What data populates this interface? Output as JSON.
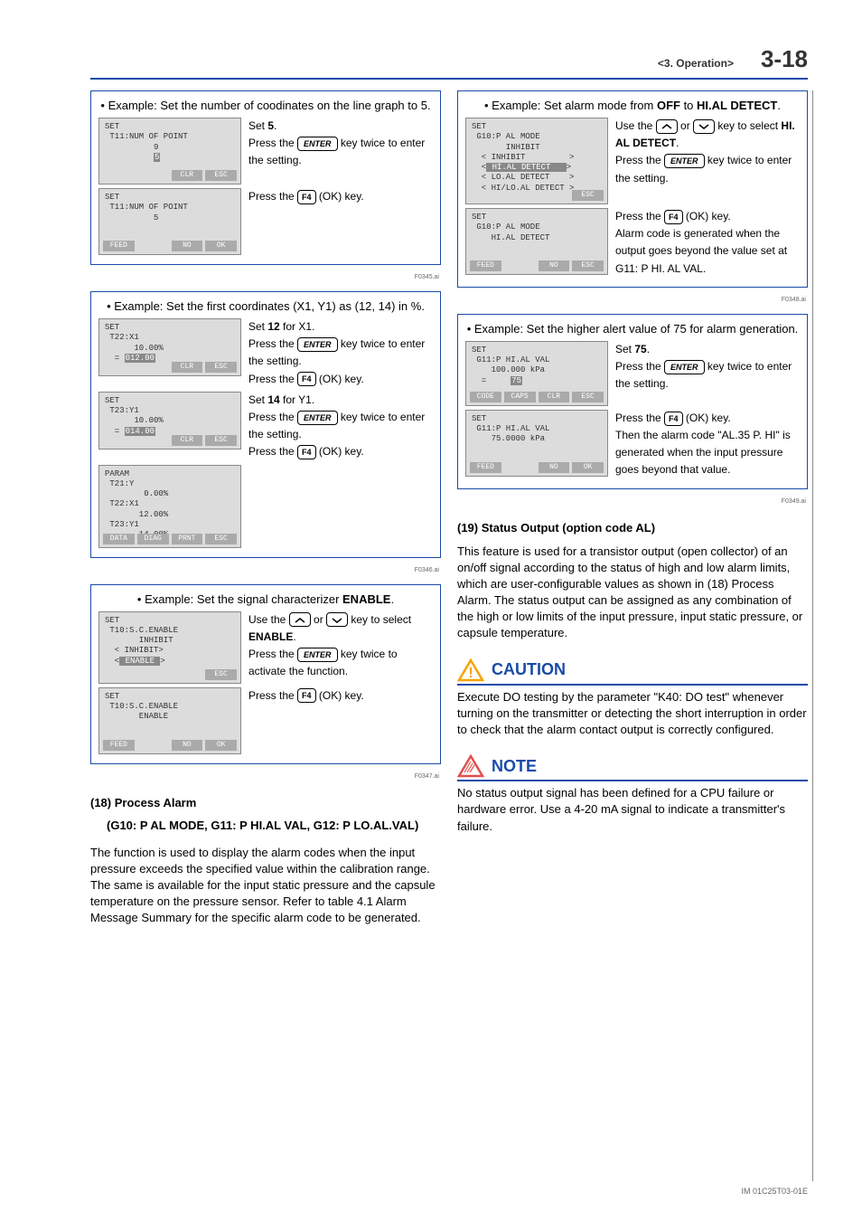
{
  "header": {
    "section": "<3. Operation>",
    "page": "3-18"
  },
  "footer": {
    "doc_id": "IM 01C25T03-01E"
  },
  "col_left": {
    "box1": {
      "title_pre": "• Example: Set the number of coodinates on the line graph to 5.",
      "lcd1": {
        "l1": "SET",
        "l2": " T11:NUM OF POINT",
        "l3": "          9",
        "l4_hl": "5",
        "foot": [
          "",
          "",
          "CLR",
          "ESC"
        ]
      },
      "instr1a": "Set ",
      "instr1b": "5",
      "instr1c": ".",
      "instr2a": "Press the ",
      "key_enter": "ENTER",
      "instr2b": " key twice to enter the setting.",
      "lcd2": {
        "l1": "SET",
        "l2": " T11:NUM OF POINT",
        "l3": "          5",
        "foot": [
          "FEED",
          "",
          "NO",
          "OK"
        ]
      },
      "instr3a": "Press the ",
      "key_f4": "F4",
      "instr3b": " (OK) key.",
      "ref": "F0345.ai"
    },
    "box2": {
      "title": "• Example: Set the first coordinates (X1, Y1) as (12, 14) in %.",
      "lcd1": {
        "l1": "SET",
        "l2": " T22:X1",
        "l3": "      10.00%",
        "l4_pre": "  = ",
        "l4_hl": "012.00",
        "foot": [
          "",
          "",
          "CLR",
          "ESC"
        ]
      },
      "i1a": "Set ",
      "i1b": "12",
      "i1c": " for X1.",
      "i2a": "Press the ",
      "i2b": " key twice to enter the setting.",
      "i3a": "Press the ",
      "i3b": " (OK) key.",
      "lcd2": {
        "l1": "SET",
        "l2": " T23:Y1",
        "l3": "      10.00%",
        "l4_pre": "  = ",
        "l4_hl": "014.00",
        "foot": [
          "",
          "",
          "CLR",
          "ESC"
        ]
      },
      "i4a": "Set ",
      "i4b": "14",
      "i4c": " for Y1.",
      "lcd3": {
        "l1": "PARAM",
        "l2": " T21:Y",
        "l3": "        0.00%",
        "l4": " T22:X1",
        "l5": "       12.00%",
        "l6": " T23:Y1",
        "l7": "       14.00%",
        "foot": [
          "DATA",
          "DIAG",
          "PRNT",
          "ESC"
        ]
      },
      "ref": "F0346.ai"
    },
    "box3": {
      "title": "• Example: Set the signal characterizer ",
      "title_b": "ENABLE",
      "title_post": ".",
      "lcd1": {
        "l1": "SET",
        "l2": " T10:S.C.ENABLE",
        "l3": "       INHIBIT",
        "l4": "  < INHIBIT>",
        "l5pre": "  <",
        "l5hl": " ENABLE ",
        "l5post": ">",
        "foot": [
          "",
          "",
          "",
          "ESC"
        ]
      },
      "i1a": "Use the ",
      "i1b": " or ",
      "i1c": " key to select ",
      "i1d": "ENABLE",
      "i1e": ".",
      "i2a": "Press the ",
      "i2b": " key twice to activate the function.",
      "lcd2": {
        "l1": "SET",
        "l2": " T10:S.C.ENABLE",
        "l3": "       ENABLE",
        "foot": [
          "FEED",
          "",
          "NO",
          "OK"
        ]
      },
      "i3a": "Press the ",
      "i3b": " (OK) key.",
      "ref": "F0347.ai"
    },
    "sec18": {
      "num": "(18) Process Alarm",
      "sub": "(G10: P AL MODE, G11: P HI.AL VAL, G12: P LO.AL.VAL)",
      "body": "The function is used to display the alarm codes when the input pressure exceeds the specified value within the calibration range. The same is available for the input static pressure and the capsule temperature on the pressure sensor. Refer to table 4.1 Alarm Message Summary for the specific alarm code to be generated."
    }
  },
  "col_right": {
    "box1": {
      "title_a": "• Example: Set alarm mode from ",
      "title_b": "OFF",
      "title_c": " to ",
      "title_d": "HI.AL DETECT",
      "title_e": ".",
      "lcd1": {
        "l1": "SET",
        "l2": " G10:P AL MODE",
        "l3": "       INHIBIT",
        "l4": "  < INHIBIT         >",
        "l5pre": "  <",
        "l5hl": " HI.AL DETECT   ",
        "l5post": ">",
        "l6": "  < LO.AL DETECT    >",
        "l7": "  < HI/LO.AL DETECT >",
        "foot": [
          "",
          "",
          "",
          "ESC"
        ]
      },
      "i1a": "Use the ",
      "i1b": " or ",
      "i1c": " key to select ",
      "i1d": "HI. AL DETECT",
      "i1e": ".",
      "i2a": "Press the ",
      "i2b": " key twice to enter the setting.",
      "lcd2": {
        "l1": "SET",
        "l2": " G10:P AL MODE",
        "l3": "    HI.AL DETECT",
        "foot": [
          "FEED",
          "",
          "NO",
          "ESC"
        ]
      },
      "i3a": "Press the ",
      "i3b": " (OK) key.",
      "i4": "Alarm code is generated when the output goes beyond the value set at G11: P HI. AL VAL.",
      "ref": "F0348.ai"
    },
    "box2": {
      "title": "• Example: Set the higher alert value of 75 for alarm generation.",
      "lcd1": {
        "l1": "SET",
        "l2": " G11:P HI.AL VAL",
        "l3": "    100.000 kPa",
        "l4pre": "  =     ",
        "l4hl": "75",
        "foot": [
          "CODE",
          "CAPS",
          "CLR",
          "ESC"
        ]
      },
      "i1a": "Set ",
      "i1b": "75",
      "i1c": ".",
      "i2a": "Press the ",
      "i2b": " key twice to enter the setting.",
      "lcd2": {
        "l1": "SET",
        "l2": " G11:P HI.AL VAL",
        "l3": "    75.0000 kPa",
        "foot": [
          "FEED",
          "",
          "NO",
          "OK"
        ]
      },
      "i3a": "Press the ",
      "i3b": " (OK) key.",
      "i4": "Then the alarm code \"AL.35 P. HI\" is generated when the input pressure goes beyond that value.",
      "ref": "F0349.ai"
    },
    "sec19": {
      "num": "(19) Status Output (option code AL)",
      "body": "This feature is used for a transistor output (open collector) of an on/off signal according to the status of high and low alarm limits, which are user-configurable values as shown in (18) Process Alarm. The status output can be assigned as any combination of the high or low limits of the input pressure, input static pressure, or capsule temperature."
    },
    "caution": {
      "title": "CAUTION",
      "body": "Execute DO testing by the parameter \"K40: DO test\" whenever turning on the transmitter or detecting the short interruption in order to check that the alarm contact output is correctly configured."
    },
    "note": {
      "title": "NOTE",
      "body": "No status output signal has been defined for a CPU failure or hardware error. Use a 4-20 mA signal to indicate a transmitter's failure."
    }
  }
}
